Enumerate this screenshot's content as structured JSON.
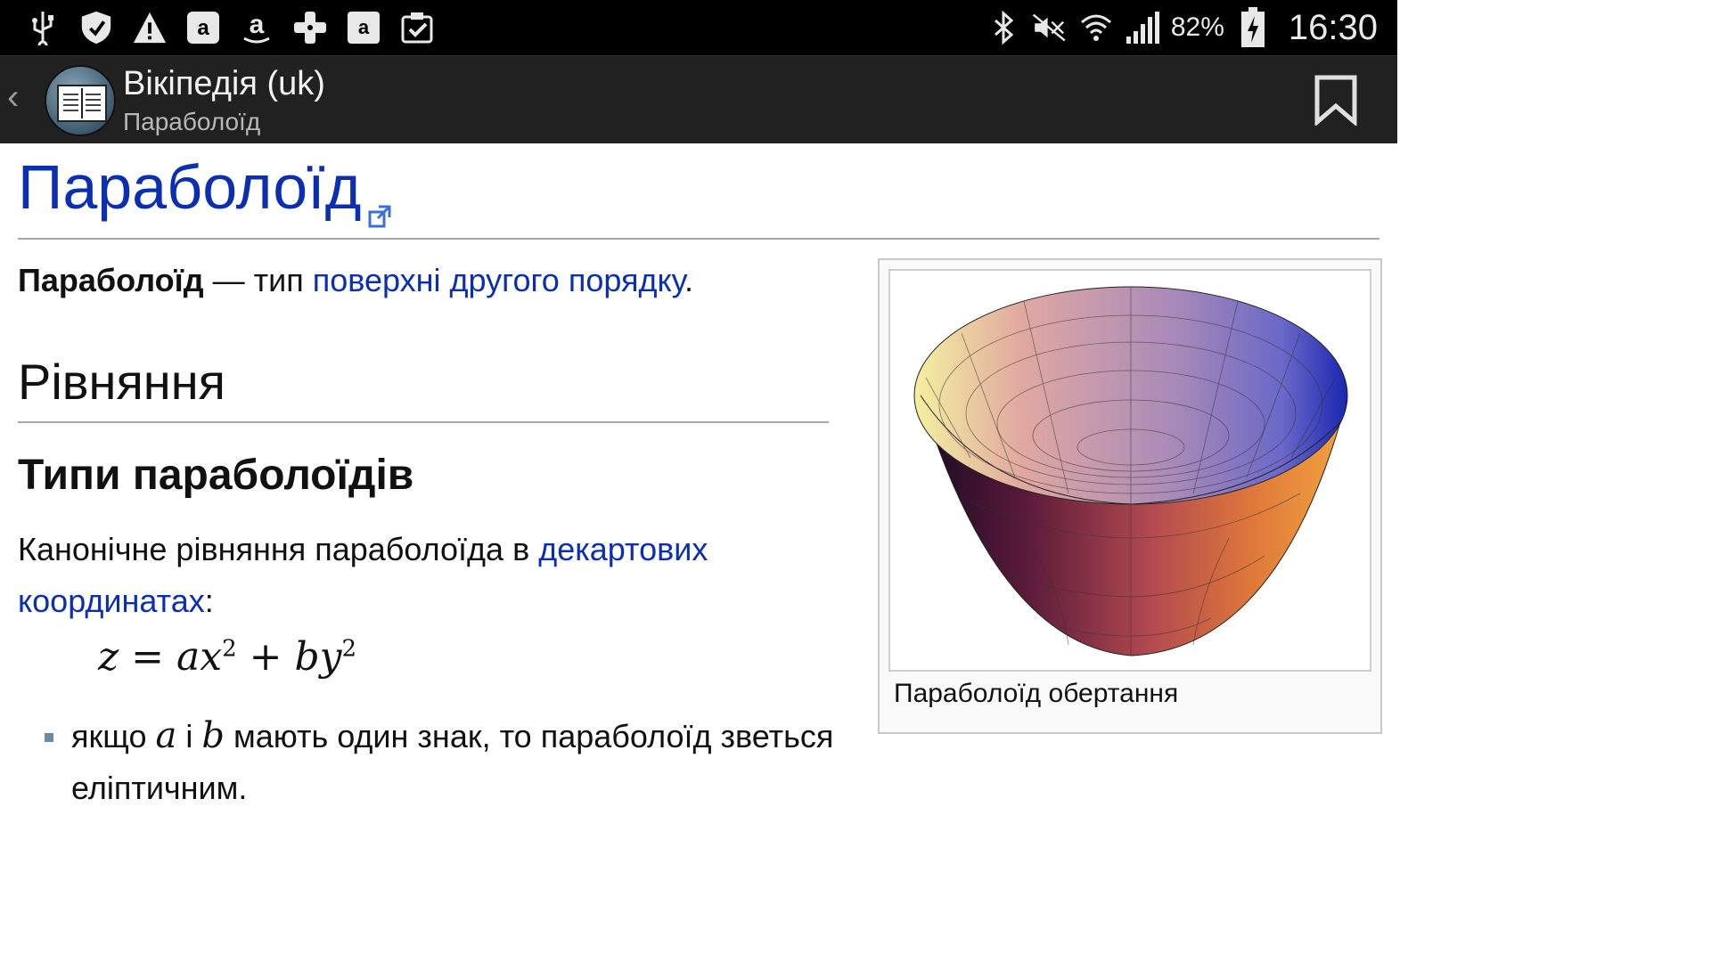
{
  "status_bar": {
    "battery": "82%",
    "time": "16:30",
    "left_icons": [
      "usb-icon",
      "shield-icon",
      "warning-icon",
      "amazon-app-icon",
      "amazon-icon",
      "game-controller-icon",
      "amazon-store-icon",
      "clipboard-check-icon"
    ],
    "right_icons": [
      "bluetooth-icon",
      "mute-icon",
      "wifi-icon",
      "signal-icon",
      "battery-charging-icon"
    ]
  },
  "app_bar": {
    "title": "Вікіпедія (uk)",
    "subtitle": "Параболоїд"
  },
  "article": {
    "title": "Параболоїд",
    "lead_bold": "Параболоїд",
    "lead_sep": " — тип ",
    "lead_link": "поверхні другого порядку",
    "lead_end": ".",
    "section_heading": "Рівняння",
    "subsection_heading": "Типи параболоїдів",
    "para_text": "Канонічне рівняння параболоїда в ",
    "para_link": "декартових координатах",
    "para_end": ":",
    "formula": {
      "z": "z",
      "eq": " = ",
      "ax": "ax",
      "plus": " + ",
      "by": "by",
      "exp1": "2",
      "exp2": "2"
    },
    "bullet": {
      "pre": "якщо ",
      "a": "a",
      "mid": " і ",
      "b": "b",
      "post": " мають один знак, то параболоїд зветься еліптичним."
    }
  },
  "figure": {
    "caption": "Параболоїд обертання"
  },
  "colors": {
    "link": "#0b2fb0",
    "appbar": "#212121",
    "statusbar": "#000000"
  }
}
